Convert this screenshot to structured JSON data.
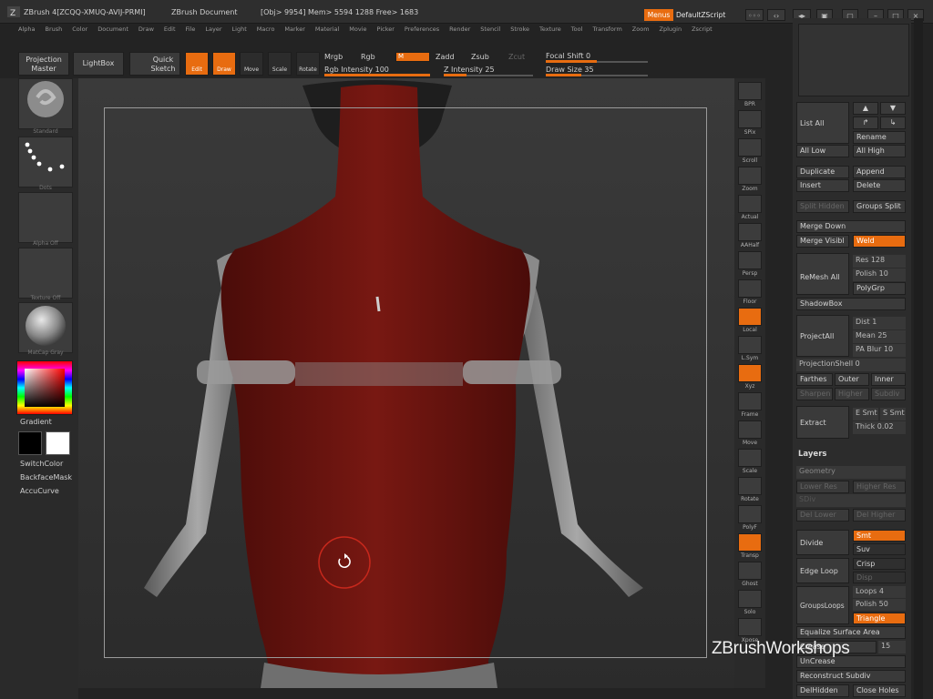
{
  "titlebar": {
    "app": "ZBrush 4[ZCQQ-XMUQ-AVIJ-PRMI]",
    "document": "ZBrush Document",
    "mem": "[Obj> 9954] Mem> 5594 1288  Free> 1683",
    "menus": "Menus",
    "script": "DefaultZScript"
  },
  "menubar": [
    "Alpha",
    "Brush",
    "Color",
    "Document",
    "Draw",
    "Edit",
    "File",
    "Layer",
    "Light",
    "Macro",
    "Marker",
    "Material",
    "Movie",
    "Picker",
    "Preferences",
    "Render",
    "Stencil",
    "Stroke",
    "Texture",
    "Tool",
    "Transform",
    "Zoom",
    "Zplugin",
    "Zscript"
  ],
  "toolbar": {
    "projection_master": "Projection Master",
    "lightbox": "LightBox",
    "quick_sketch": "Quick Sketch",
    "edit": "Edit",
    "draw": "Draw",
    "move": "Move",
    "scale": "Scale",
    "rotate": "Rotate",
    "mrgb": "Mrgb",
    "rgb": "Rgb",
    "m": "M",
    "zadd": "Zadd",
    "zsub": "Zsub",
    "zcut": "Zcut",
    "rgb_intensity_label": "Rgb Intensity",
    "rgb_intensity_value": "100",
    "z_intensity_label": "Z Intensity",
    "z_intensity_value": "25",
    "focal_shift_label": "Focal Shift",
    "focal_shift_value": "0",
    "draw_size_label": "Draw Size",
    "draw_size_value": "35",
    "rgb_intensity": 1.0,
    "z_intensity": 0.25,
    "focal_shift": 0.5,
    "draw_size": 0.35
  },
  "leftshelf": {
    "brush": "Standard",
    "stroke": "Dots",
    "alpha": "Alpha Off",
    "texture": "Texture Off",
    "material": "MatCap Gray",
    "gradient": "Gradient",
    "switch_color": "SwitchColor",
    "backface": "BackfaceMask",
    "accucurve": "AccuCurve"
  },
  "rightshelf": [
    "BPR",
    "SPix",
    "Scroll",
    "Zoom",
    "Actual",
    "AAHalf",
    "Persp",
    "Floor",
    "Local",
    "L.Sym",
    "Xyz",
    "Frame",
    "Move",
    "Scale",
    "Rotate",
    "PolyF",
    "Transp",
    "Ghost",
    "Solo",
    "Xpose"
  ],
  "tray": {
    "list_all": "List All",
    "rename": "Rename",
    "all_low": "All Low",
    "all_high": "All High",
    "duplicate": "Duplicate",
    "append": "Append",
    "insert": "Insert",
    "delete": "Delete",
    "split_hidden": "Split Hidden",
    "groups_split": "Groups Split",
    "merge_down": "Merge Down",
    "merge_visible": "Merge Visibl",
    "weld": "Weld",
    "remesh_all": "ReMesh All",
    "res_label": "Res",
    "res_value": "128",
    "polish_label": "Polish",
    "polish_value": "10",
    "polygrp": "PolyGrp",
    "shadowbox": "ShadowBox",
    "project_all": "ProjectAll",
    "dist_label": "Dist",
    "dist_value": "1",
    "mean_label": "Mean",
    "mean_value": "25",
    "pa_blur_label": "PA Blur",
    "pa_blur_value": "10",
    "projection_shell_label": "ProjectionShell",
    "projection_shell_value": "0",
    "farthest": "Farthes",
    "outer": "Outer",
    "inner": "Inner",
    "sharpen": "Sharpen",
    "higher": "Higher",
    "subdiv": "Subdiv",
    "extract": "Extract",
    "e_smt": "E Smt",
    "s_smt": "S Smt",
    "thick_label": "Thick",
    "thick_value": "0.02",
    "layers": "Layers",
    "geometry": "Geometry",
    "lower_res": "Lower Res",
    "higher_res": "Higher Res",
    "sdiv": "SDiv",
    "reconstruct_lower": "Del Lower",
    "del_higher": "Del Higher",
    "divide": "Divide",
    "smt": "Smt",
    "suv": "Suv",
    "edge_loop": "Edge Loop",
    "crisp": "Crisp",
    "disp": "Disp",
    "groups_loops": "GroupsLoops",
    "loops_label": "Loops",
    "loops_value": "4",
    "polish2_label": "Polish",
    "polish2_value": "50",
    "triangle": "Triangle",
    "equalize": "Equalize Surface Area",
    "crease": "Crease",
    "creaselvl_value": "15",
    "uncrease": "UnCrease",
    "reconstruct": "Reconstruct Subdiv",
    "delhidden": "DelHidden",
    "close_holes": "Close Holes"
  },
  "watermark": "ZBrushWorkshops",
  "colors": {
    "accent": "#e86c10",
    "muscle": "#6b1410",
    "bone": "#8a8a8a"
  },
  "icons": [
    "rotate-cursor-icon",
    "sphere-brush-icon",
    "stroke-dots-icon"
  ]
}
